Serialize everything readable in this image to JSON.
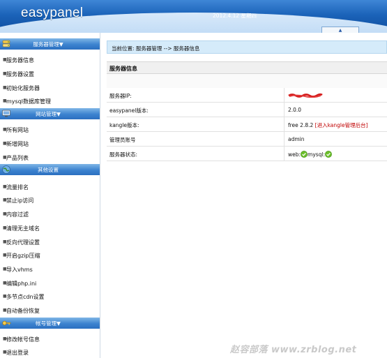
{
  "header": {
    "logo": "easypanel",
    "date": "2012.4.12 星期四",
    "toggle_symbol": "▲"
  },
  "sidebar": {
    "sections": [
      {
        "title": "服务器管理",
        "arrow": "▼",
        "icon": "server-icon",
        "items": [
          "服务器信息",
          "服务器设置",
          "初始化服务器",
          "mysql数据库管理"
        ]
      },
      {
        "title": "网站管理",
        "arrow": "▼",
        "icon": "monitor-icon",
        "items": [
          "所有网站",
          "新增网站",
          "产品列表"
        ]
      },
      {
        "title": "其他设置",
        "arrow": "",
        "icon": "globe-icon",
        "items": [
          "流量排名",
          "禁止ip访问",
          "内容过滤",
          "清理无主域名",
          "反向代理设置",
          "开启gzip压缩",
          "导入vhms",
          "编辑php.ini",
          "多节点cdn设置",
          "自动备份恢复"
        ]
      },
      {
        "title": "帐号管理",
        "arrow": "▼",
        "icon": "key-icon",
        "items": [
          "修改帐号信息",
          "退出登录"
        ]
      }
    ]
  },
  "main": {
    "breadcrumb": "当前位置: 服务器管理 --> 服务器信息",
    "panel_title": "服务器信息",
    "rows": [
      {
        "key": "服务器IP:",
        "value": "",
        "redacted": true
      },
      {
        "key": "easypanel版本:",
        "value": "2.0.0"
      },
      {
        "key": "kangle版本:",
        "value": "free 2.8.2",
        "link": "[进入kangle管理后台]"
      },
      {
        "key": "管理员账号",
        "value": "admin"
      },
      {
        "key": "服务器状态:",
        "web_label": "web:",
        "mysql_label": "mysql:"
      }
    ]
  },
  "watermark": "赵容部落 www.zrblog.net",
  "colors": {
    "header_blue": "#1b63b9",
    "section_blue": "#3c83cf",
    "breadcrumb_bg": "#d5ebfa",
    "link_red": "#c00000",
    "ok_green": "#6cbf2a"
  }
}
